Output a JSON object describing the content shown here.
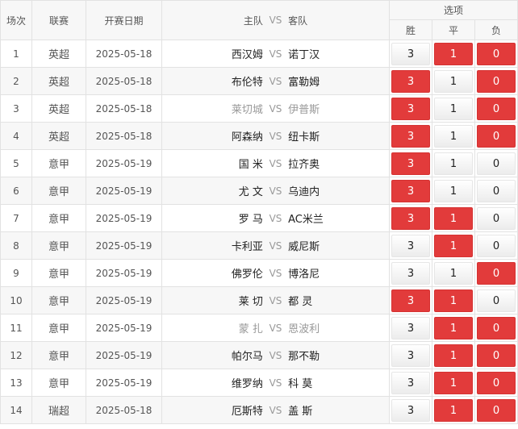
{
  "header": {
    "idx": "场次",
    "league": "联赛",
    "date": "开赛日期",
    "home": "主队",
    "vs": "VS",
    "away": "客队",
    "options": "选项",
    "win": "胜",
    "draw": "平",
    "loss": "负"
  },
  "rows": [
    {
      "idx": "1",
      "league": "英超",
      "date": "2025-05-18",
      "home": "西汉姆",
      "vs": "VS",
      "away": "诺丁汉",
      "win": "3",
      "draw": "1",
      "loss": "0",
      "sel": [
        false,
        true,
        true
      ],
      "muted": false
    },
    {
      "idx": "2",
      "league": "英超",
      "date": "2025-05-18",
      "home": "布伦特",
      "vs": "VS",
      "away": "富勒姆",
      "win": "3",
      "draw": "1",
      "loss": "0",
      "sel": [
        true,
        false,
        true
      ],
      "muted": false
    },
    {
      "idx": "3",
      "league": "英超",
      "date": "2025-05-18",
      "home": "莱切城",
      "vs": "VS",
      "away": "伊普斯",
      "win": "3",
      "draw": "1",
      "loss": "0",
      "sel": [
        true,
        false,
        true
      ],
      "muted": true
    },
    {
      "idx": "4",
      "league": "英超",
      "date": "2025-05-18",
      "home": "阿森纳",
      "vs": "VS",
      "away": "纽卡斯",
      "win": "3",
      "draw": "1",
      "loss": "0",
      "sel": [
        true,
        false,
        true
      ],
      "muted": false
    },
    {
      "idx": "5",
      "league": "意甲",
      "date": "2025-05-19",
      "home": "国 米",
      "vs": "VS",
      "away": "拉齐奥",
      "win": "3",
      "draw": "1",
      "loss": "0",
      "sel": [
        true,
        false,
        false
      ],
      "muted": false
    },
    {
      "idx": "6",
      "league": "意甲",
      "date": "2025-05-19",
      "home": "尤 文",
      "vs": "VS",
      "away": "乌迪内",
      "win": "3",
      "draw": "1",
      "loss": "0",
      "sel": [
        true,
        false,
        false
      ],
      "muted": false
    },
    {
      "idx": "7",
      "league": "意甲",
      "date": "2025-05-19",
      "home": "罗 马",
      "vs": "VS",
      "away": "AC米兰",
      "win": "3",
      "draw": "1",
      "loss": "0",
      "sel": [
        true,
        true,
        false
      ],
      "muted": false
    },
    {
      "idx": "8",
      "league": "意甲",
      "date": "2025-05-19",
      "home": "卡利亚",
      "vs": "VS",
      "away": "威尼斯",
      "win": "3",
      "draw": "1",
      "loss": "0",
      "sel": [
        false,
        true,
        false
      ],
      "muted": false
    },
    {
      "idx": "9",
      "league": "意甲",
      "date": "2025-05-19",
      "home": "佛罗伦",
      "vs": "VS",
      "away": "博洛尼",
      "win": "3",
      "draw": "1",
      "loss": "0",
      "sel": [
        false,
        false,
        true
      ],
      "muted": false
    },
    {
      "idx": "10",
      "league": "意甲",
      "date": "2025-05-19",
      "home": "莱 切",
      "vs": "VS",
      "away": "都 灵",
      "win": "3",
      "draw": "1",
      "loss": "0",
      "sel": [
        true,
        true,
        false
      ],
      "muted": false
    },
    {
      "idx": "11",
      "league": "意甲",
      "date": "2025-05-19",
      "home": "蒙 扎",
      "vs": "VS",
      "away": "恩波利",
      "win": "3",
      "draw": "1",
      "loss": "0",
      "sel": [
        false,
        true,
        true
      ],
      "muted": true
    },
    {
      "idx": "12",
      "league": "意甲",
      "date": "2025-05-19",
      "home": "帕尔马",
      "vs": "VS",
      "away": "那不勒",
      "win": "3",
      "draw": "1",
      "loss": "0",
      "sel": [
        false,
        true,
        true
      ],
      "muted": false
    },
    {
      "idx": "13",
      "league": "意甲",
      "date": "2025-05-19",
      "home": "维罗纳",
      "vs": "VS",
      "away": "科 莫",
      "win": "3",
      "draw": "1",
      "loss": "0",
      "sel": [
        false,
        true,
        true
      ],
      "muted": false
    },
    {
      "idx": "14",
      "league": "瑞超",
      "date": "2025-05-18",
      "home": "厄斯特",
      "vs": "VS",
      "away": "盖 斯",
      "win": "3",
      "draw": "1",
      "loss": "0",
      "sel": [
        false,
        true,
        true
      ],
      "muted": false
    }
  ],
  "colors": {
    "selected": "#e23b3b",
    "header_bg": "#f7f7f7",
    "muted_text": "#999999"
  }
}
